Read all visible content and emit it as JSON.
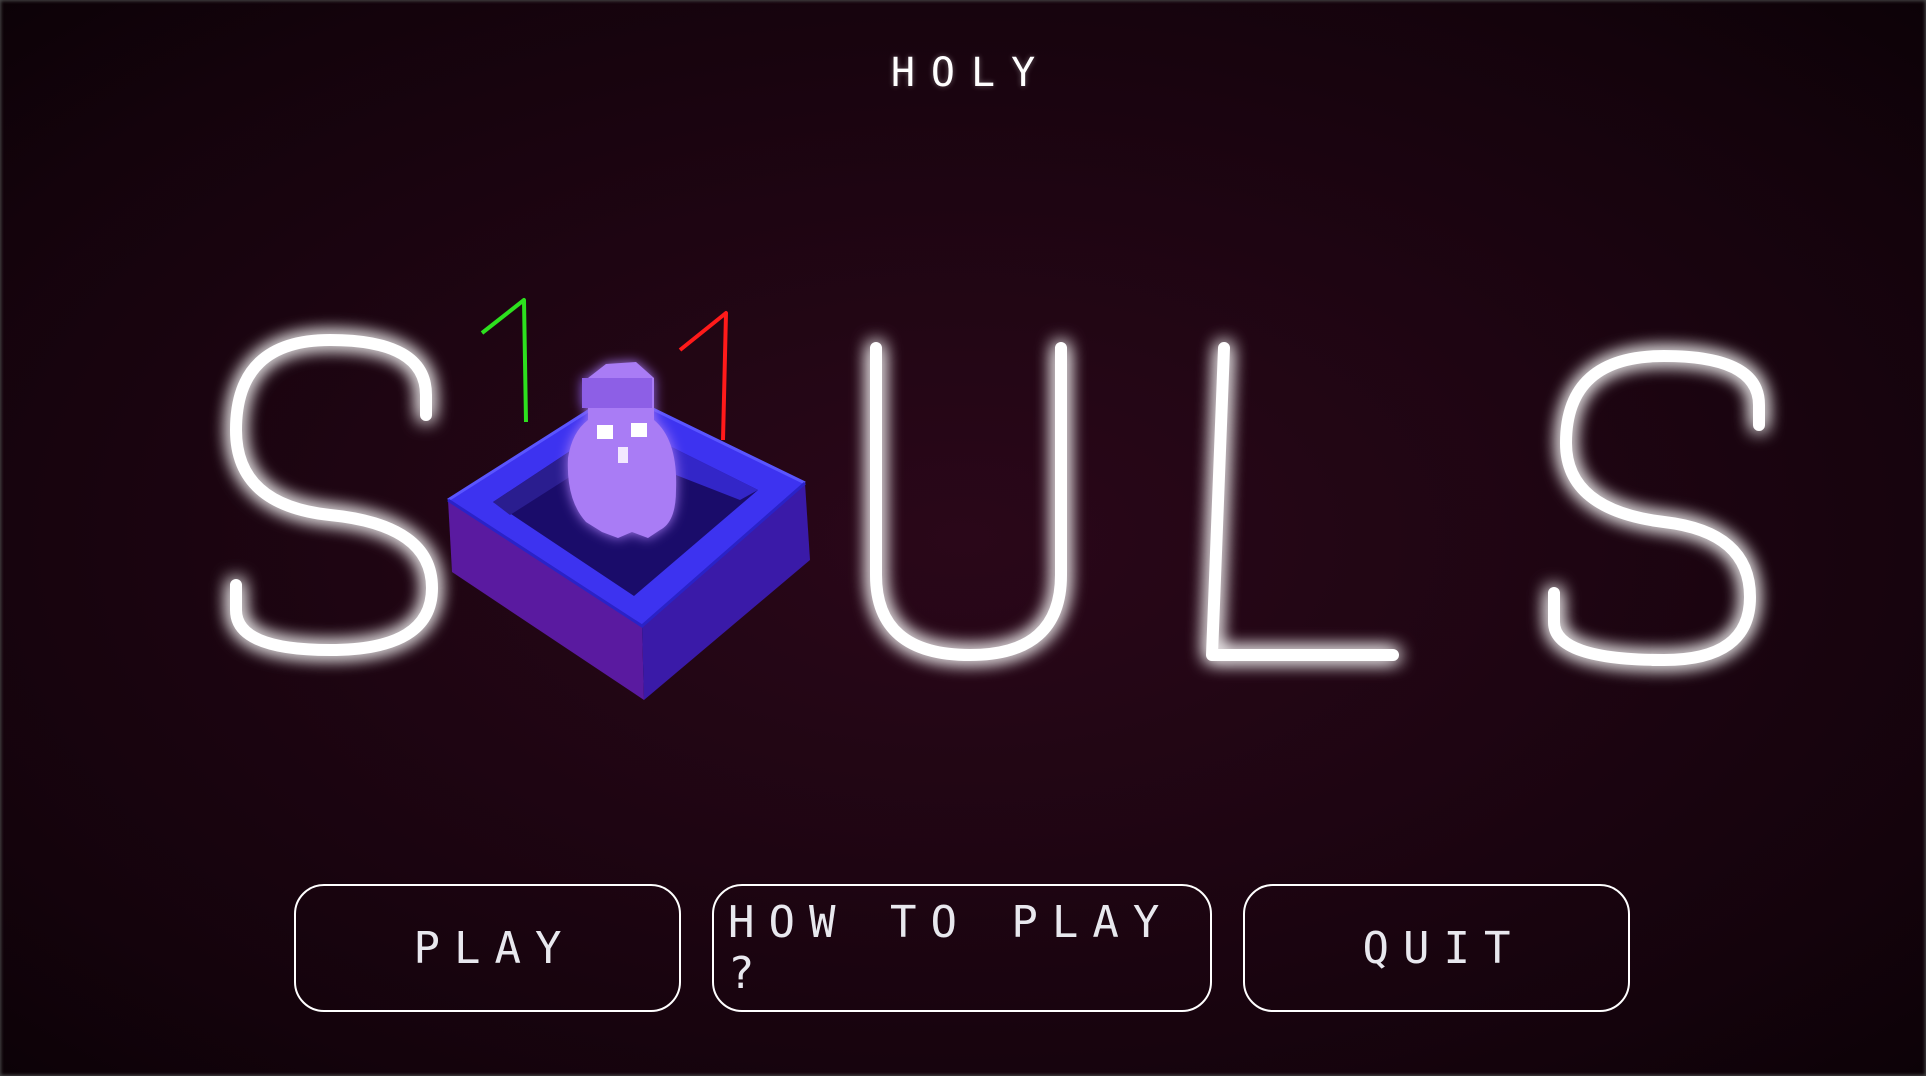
{
  "game": {
    "title_small": "HOLY",
    "title_large": "SOULS",
    "character": "ghost-in-box-icon"
  },
  "menu": {
    "play_label": "PLAY",
    "how_to_play_label": "HOW TO PLAY ?",
    "quit_label": "QUIT"
  },
  "colors": {
    "background": "#1e0512",
    "neon_letters": "#ffffff",
    "neon_glow": "#b8a8ff",
    "box": "#3a2ee0",
    "ghost": "#a97cf5",
    "axis_green": "#2de11e",
    "axis_red": "#ff1a1a"
  }
}
